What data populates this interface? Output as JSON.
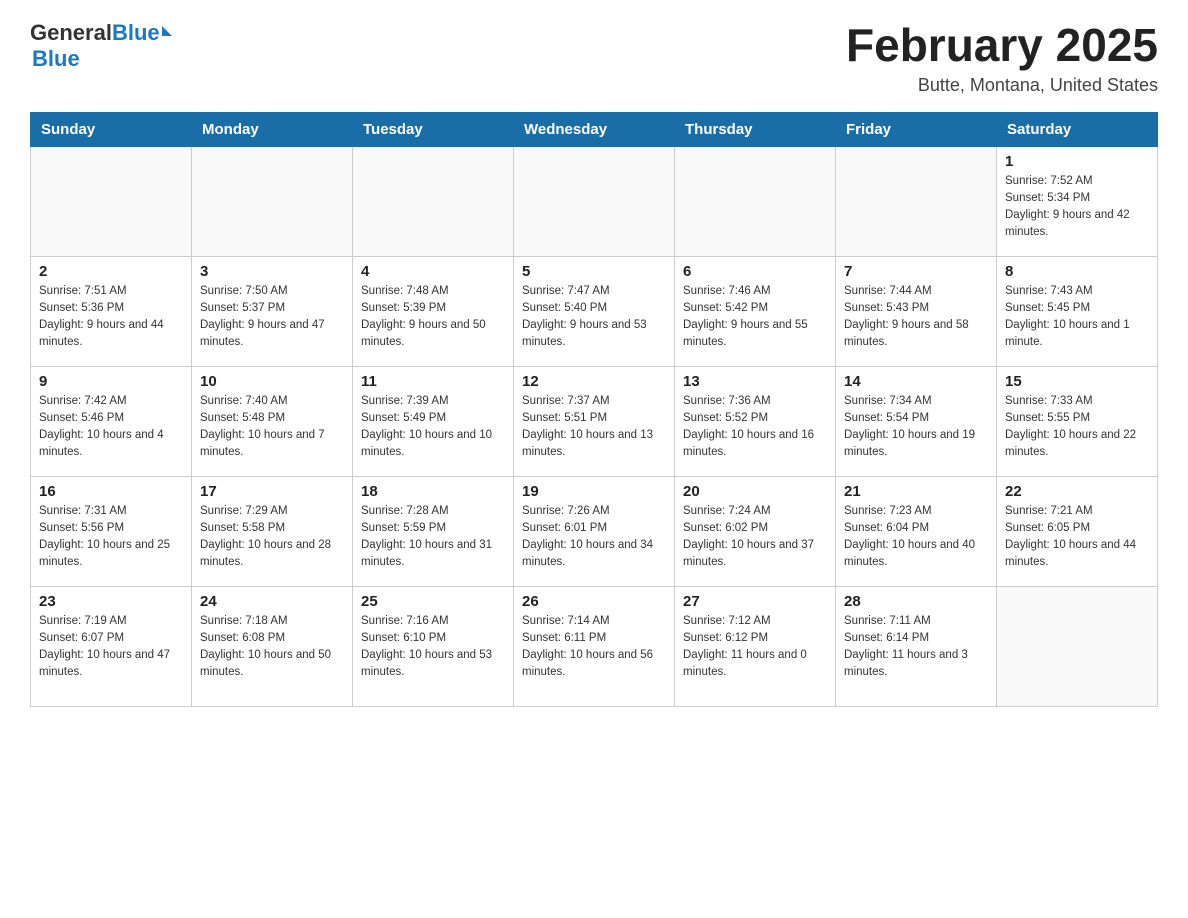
{
  "header": {
    "logo_general": "General",
    "logo_blue": "Blue",
    "month_title": "February 2025",
    "location": "Butte, Montana, United States"
  },
  "weekdays": [
    "Sunday",
    "Monday",
    "Tuesday",
    "Wednesday",
    "Thursday",
    "Friday",
    "Saturday"
  ],
  "weeks": [
    [
      {
        "day": "",
        "info": ""
      },
      {
        "day": "",
        "info": ""
      },
      {
        "day": "",
        "info": ""
      },
      {
        "day": "",
        "info": ""
      },
      {
        "day": "",
        "info": ""
      },
      {
        "day": "",
        "info": ""
      },
      {
        "day": "1",
        "info": "Sunrise: 7:52 AM\nSunset: 5:34 PM\nDaylight: 9 hours and 42 minutes."
      }
    ],
    [
      {
        "day": "2",
        "info": "Sunrise: 7:51 AM\nSunset: 5:36 PM\nDaylight: 9 hours and 44 minutes."
      },
      {
        "day": "3",
        "info": "Sunrise: 7:50 AM\nSunset: 5:37 PM\nDaylight: 9 hours and 47 minutes."
      },
      {
        "day": "4",
        "info": "Sunrise: 7:48 AM\nSunset: 5:39 PM\nDaylight: 9 hours and 50 minutes."
      },
      {
        "day": "5",
        "info": "Sunrise: 7:47 AM\nSunset: 5:40 PM\nDaylight: 9 hours and 53 minutes."
      },
      {
        "day": "6",
        "info": "Sunrise: 7:46 AM\nSunset: 5:42 PM\nDaylight: 9 hours and 55 minutes."
      },
      {
        "day": "7",
        "info": "Sunrise: 7:44 AM\nSunset: 5:43 PM\nDaylight: 9 hours and 58 minutes."
      },
      {
        "day": "8",
        "info": "Sunrise: 7:43 AM\nSunset: 5:45 PM\nDaylight: 10 hours and 1 minute."
      }
    ],
    [
      {
        "day": "9",
        "info": "Sunrise: 7:42 AM\nSunset: 5:46 PM\nDaylight: 10 hours and 4 minutes."
      },
      {
        "day": "10",
        "info": "Sunrise: 7:40 AM\nSunset: 5:48 PM\nDaylight: 10 hours and 7 minutes."
      },
      {
        "day": "11",
        "info": "Sunrise: 7:39 AM\nSunset: 5:49 PM\nDaylight: 10 hours and 10 minutes."
      },
      {
        "day": "12",
        "info": "Sunrise: 7:37 AM\nSunset: 5:51 PM\nDaylight: 10 hours and 13 minutes."
      },
      {
        "day": "13",
        "info": "Sunrise: 7:36 AM\nSunset: 5:52 PM\nDaylight: 10 hours and 16 minutes."
      },
      {
        "day": "14",
        "info": "Sunrise: 7:34 AM\nSunset: 5:54 PM\nDaylight: 10 hours and 19 minutes."
      },
      {
        "day": "15",
        "info": "Sunrise: 7:33 AM\nSunset: 5:55 PM\nDaylight: 10 hours and 22 minutes."
      }
    ],
    [
      {
        "day": "16",
        "info": "Sunrise: 7:31 AM\nSunset: 5:56 PM\nDaylight: 10 hours and 25 minutes."
      },
      {
        "day": "17",
        "info": "Sunrise: 7:29 AM\nSunset: 5:58 PM\nDaylight: 10 hours and 28 minutes."
      },
      {
        "day": "18",
        "info": "Sunrise: 7:28 AM\nSunset: 5:59 PM\nDaylight: 10 hours and 31 minutes."
      },
      {
        "day": "19",
        "info": "Sunrise: 7:26 AM\nSunset: 6:01 PM\nDaylight: 10 hours and 34 minutes."
      },
      {
        "day": "20",
        "info": "Sunrise: 7:24 AM\nSunset: 6:02 PM\nDaylight: 10 hours and 37 minutes."
      },
      {
        "day": "21",
        "info": "Sunrise: 7:23 AM\nSunset: 6:04 PM\nDaylight: 10 hours and 40 minutes."
      },
      {
        "day": "22",
        "info": "Sunrise: 7:21 AM\nSunset: 6:05 PM\nDaylight: 10 hours and 44 minutes."
      }
    ],
    [
      {
        "day": "23",
        "info": "Sunrise: 7:19 AM\nSunset: 6:07 PM\nDaylight: 10 hours and 47 minutes."
      },
      {
        "day": "24",
        "info": "Sunrise: 7:18 AM\nSunset: 6:08 PM\nDaylight: 10 hours and 50 minutes."
      },
      {
        "day": "25",
        "info": "Sunrise: 7:16 AM\nSunset: 6:10 PM\nDaylight: 10 hours and 53 minutes."
      },
      {
        "day": "26",
        "info": "Sunrise: 7:14 AM\nSunset: 6:11 PM\nDaylight: 10 hours and 56 minutes."
      },
      {
        "day": "27",
        "info": "Sunrise: 7:12 AM\nSunset: 6:12 PM\nDaylight: 11 hours and 0 minutes."
      },
      {
        "day": "28",
        "info": "Sunrise: 7:11 AM\nSunset: 6:14 PM\nDaylight: 11 hours and 3 minutes."
      },
      {
        "day": "",
        "info": ""
      }
    ]
  ]
}
